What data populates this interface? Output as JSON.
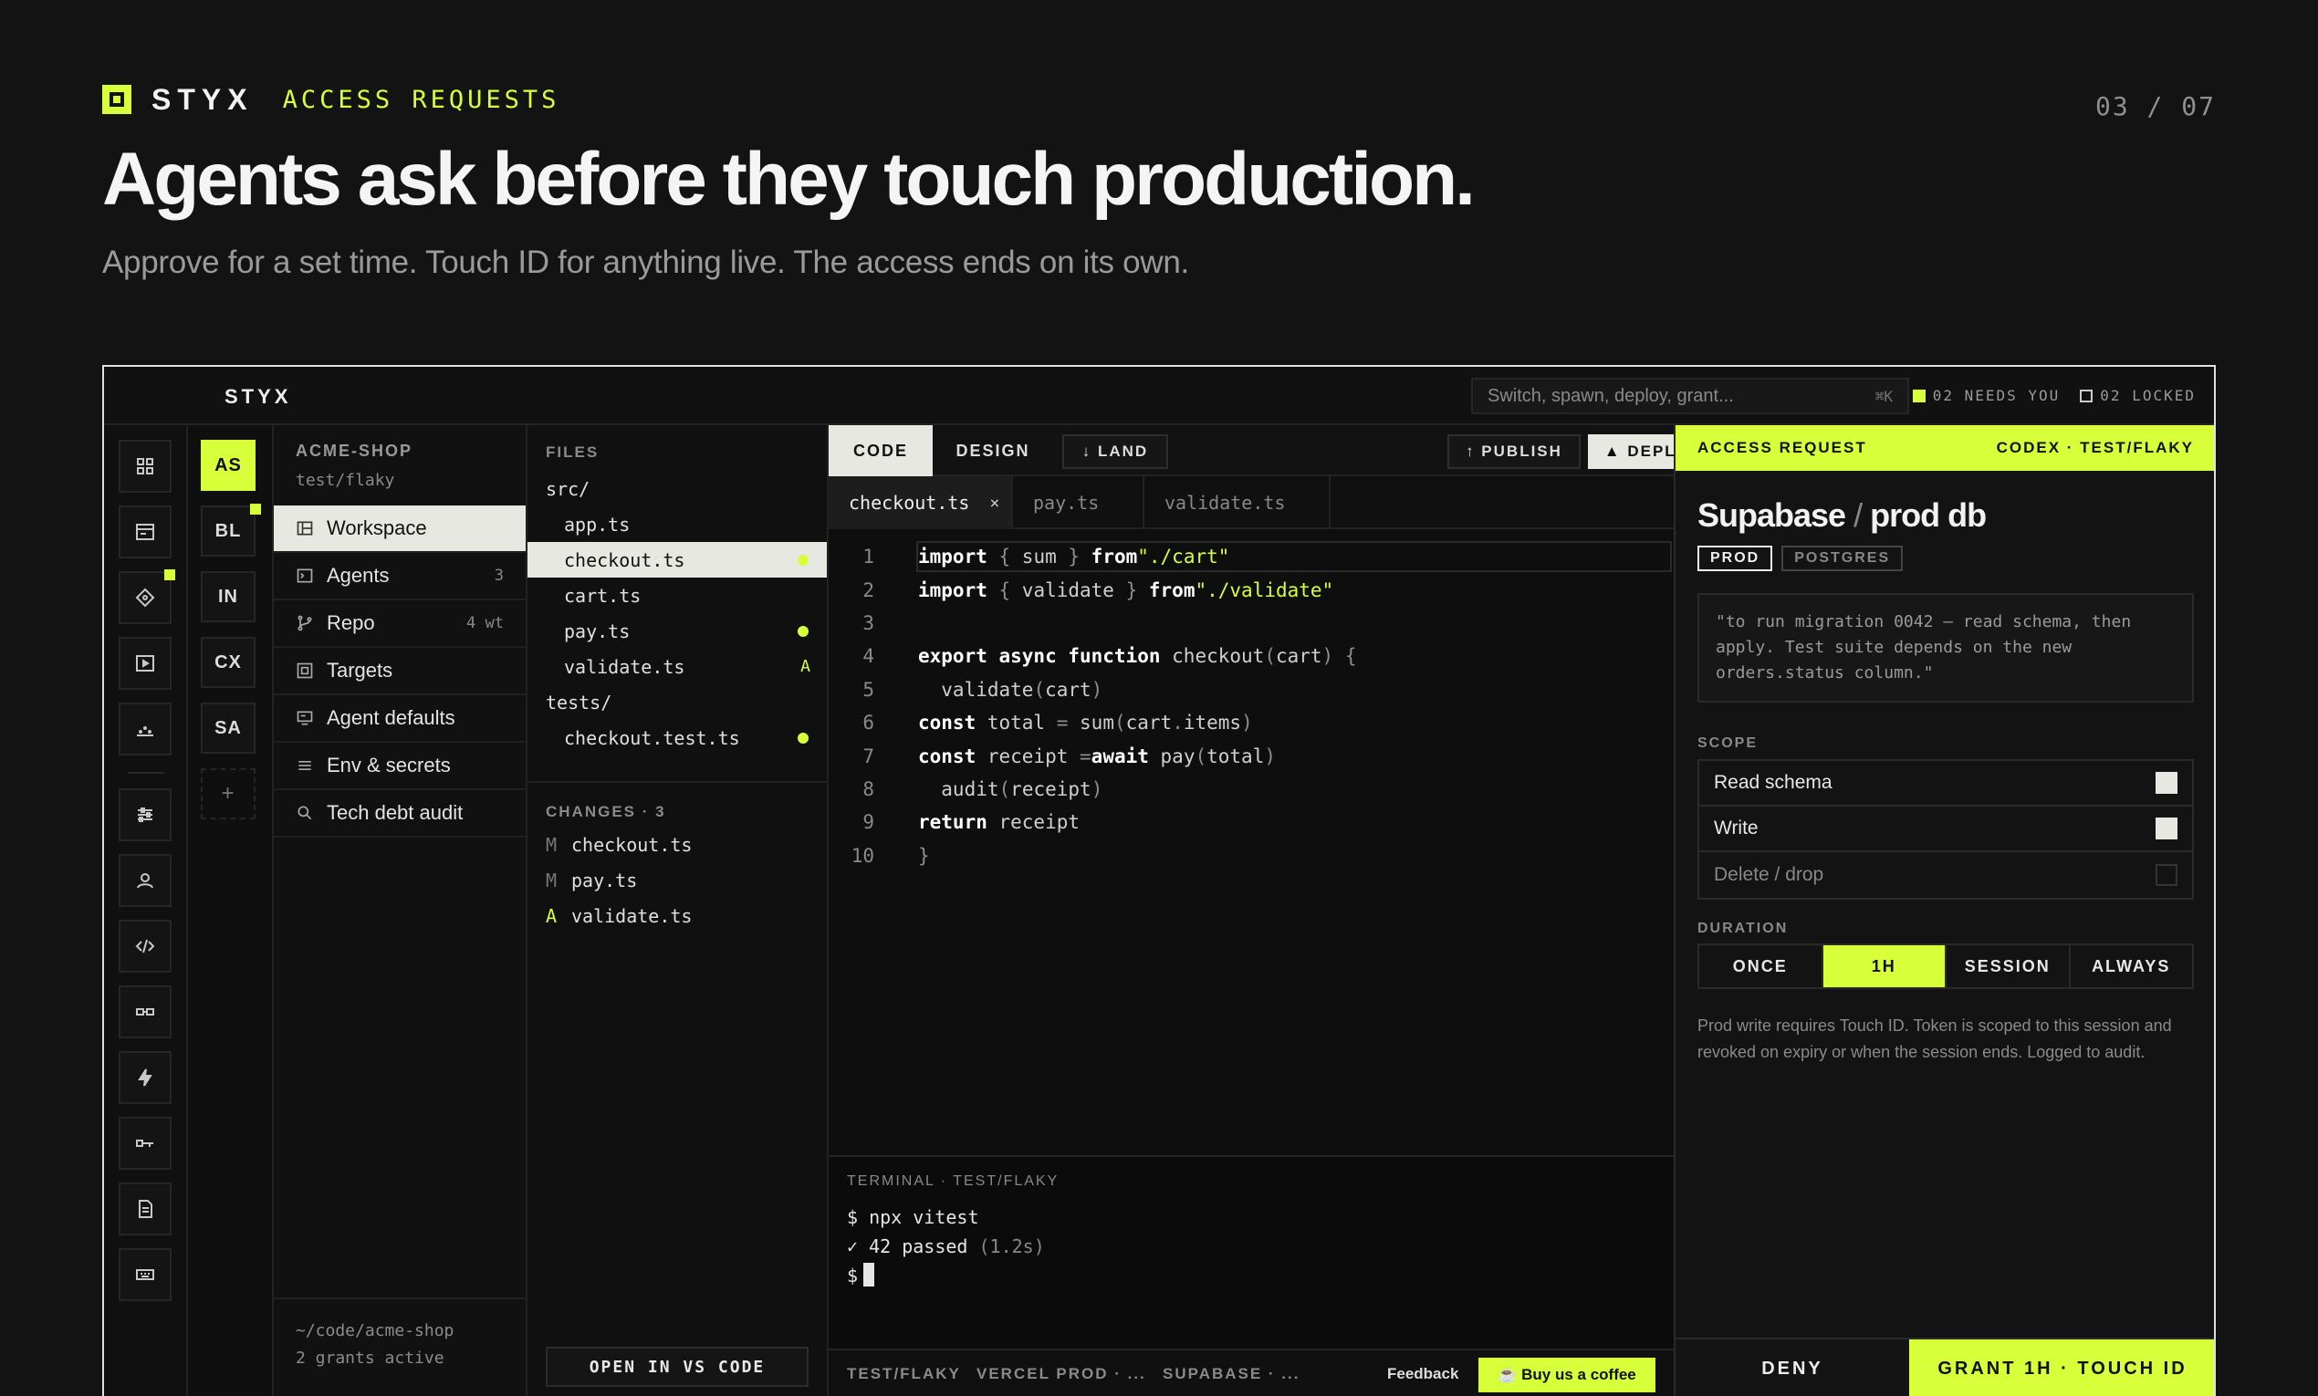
{
  "slide": {
    "brand": "STYX",
    "section": "ACCESS REQUESTS",
    "pager": "03 / 07",
    "headline": "Agents ask before they touch production.",
    "subline": "Approve for a set time. Touch ID for anything live. The access ends on its own."
  },
  "topbar": {
    "brand": "STYX",
    "search_placeholder": "Switch, spawn, deploy, grant...",
    "search_shortcut": "⌘K",
    "needs_you": "02 NEEDS YOU",
    "locked": "02 LOCKED"
  },
  "icon_rail": [
    "dashboard-icon",
    "terminal-window-icon",
    "diamond-icon",
    "play-icon",
    "chart-icon",
    "sliders-icon",
    "user-icon",
    "code-icon",
    "link-icon",
    "bolt-icon",
    "key-icon",
    "document-icon",
    "keyboard-icon"
  ],
  "agents": [
    {
      "label": "AS",
      "active": true
    },
    {
      "label": "BL"
    },
    {
      "label": "IN"
    },
    {
      "label": "CX"
    },
    {
      "label": "SA"
    },
    {
      "label": "+"
    }
  ],
  "project": {
    "name": "ACME-SHOP",
    "branch": "test/flaky",
    "items": [
      {
        "label": "Workspace",
        "count": ""
      },
      {
        "label": "Agents",
        "count": "3"
      },
      {
        "label": "Repo",
        "count": "4 wt"
      },
      {
        "label": "Targets",
        "count": ""
      },
      {
        "label": "Agent defaults",
        "count": ""
      },
      {
        "label": "Env & secrets",
        "count": ""
      },
      {
        "label": "Tech debt audit",
        "count": ""
      }
    ],
    "footer_path": "~/code/acme-shop",
    "footer_grants": "2 grants active"
  },
  "files": {
    "header": "FILES",
    "tree": [
      {
        "name": "src/",
        "indent": 0,
        "marker": ""
      },
      {
        "name": "app.ts",
        "indent": 1,
        "marker": ""
      },
      {
        "name": "checkout.ts",
        "indent": 1,
        "marker": "dot",
        "active": true
      },
      {
        "name": "cart.ts",
        "indent": 1,
        "marker": ""
      },
      {
        "name": "pay.ts",
        "indent": 1,
        "marker": "dot"
      },
      {
        "name": "validate.ts",
        "indent": 1,
        "marker": "A"
      },
      {
        "name": "tests/",
        "indent": 0,
        "marker": ""
      },
      {
        "name": "checkout.test.ts",
        "indent": 1,
        "marker": "dot"
      }
    ],
    "changes_header": "CHANGES · 3",
    "changes": [
      {
        "status": "M",
        "name": "checkout.ts"
      },
      {
        "status": "M",
        "name": "pay.ts"
      },
      {
        "status": "A",
        "name": "validate.ts"
      }
    ],
    "open_button": "OPEN IN VS CODE"
  },
  "editor": {
    "mode_tabs": [
      "CODE",
      "DESIGN"
    ],
    "land": "↓ LAND",
    "publish": "↑ PUBLISH",
    "deploy": "▲ DEPLOY TO ▾",
    "file_tabs": [
      {
        "name": "checkout.ts",
        "active": true,
        "close": "×"
      },
      {
        "name": "pay.ts"
      },
      {
        "name": "validate.ts"
      }
    ],
    "code_lines": [
      "1",
      "2",
      "3",
      "4",
      "5",
      "6",
      "7",
      "8",
      "9",
      "10"
    ],
    "terminal_header": "TERMINAL · TEST/FLAKY",
    "terminal_lines": [
      "$ npx vitest",
      "✓ 42 passed",
      "(1.2s)",
      "$"
    ],
    "status_items": [
      "TEST/FLAKY",
      "VERCEL PROD · ...",
      "SUPABASE · ..."
    ],
    "feedback": "Feedback",
    "coffee": "☕ Buy us a coffee"
  },
  "access": {
    "header_left": "ACCESS REQUEST",
    "header_right": "CODEX · TEST/FLAKY",
    "title_service": "Supabase",
    "title_sep": " / ",
    "title_resource": "prod db",
    "tags": [
      "PROD",
      "POSTGRES"
    ],
    "quote": "\"to run migration 0042 — read schema, then apply. Test suite depends on the new orders.status column.\"",
    "scope_label": "SCOPE",
    "scopes": [
      {
        "label": "Read schema",
        "checked": true
      },
      {
        "label": "Write",
        "checked": true
      },
      {
        "label": "Delete / drop",
        "checked": false
      }
    ],
    "duration_label": "DURATION",
    "durations": [
      "ONCE",
      "1H",
      "SESSION",
      "ALWAYS"
    ],
    "duration_selected": "1H",
    "note": "Prod write requires Touch ID. Token is scoped to this session and revoked on expiry or when the session ends. Logged to audit.",
    "deny": "DENY",
    "grant": "GRANT 1H · TOUCH ID"
  },
  "colors": {
    "accent": "#d7ff3a",
    "background": "#131313",
    "panel": "#0e0e0e"
  }
}
